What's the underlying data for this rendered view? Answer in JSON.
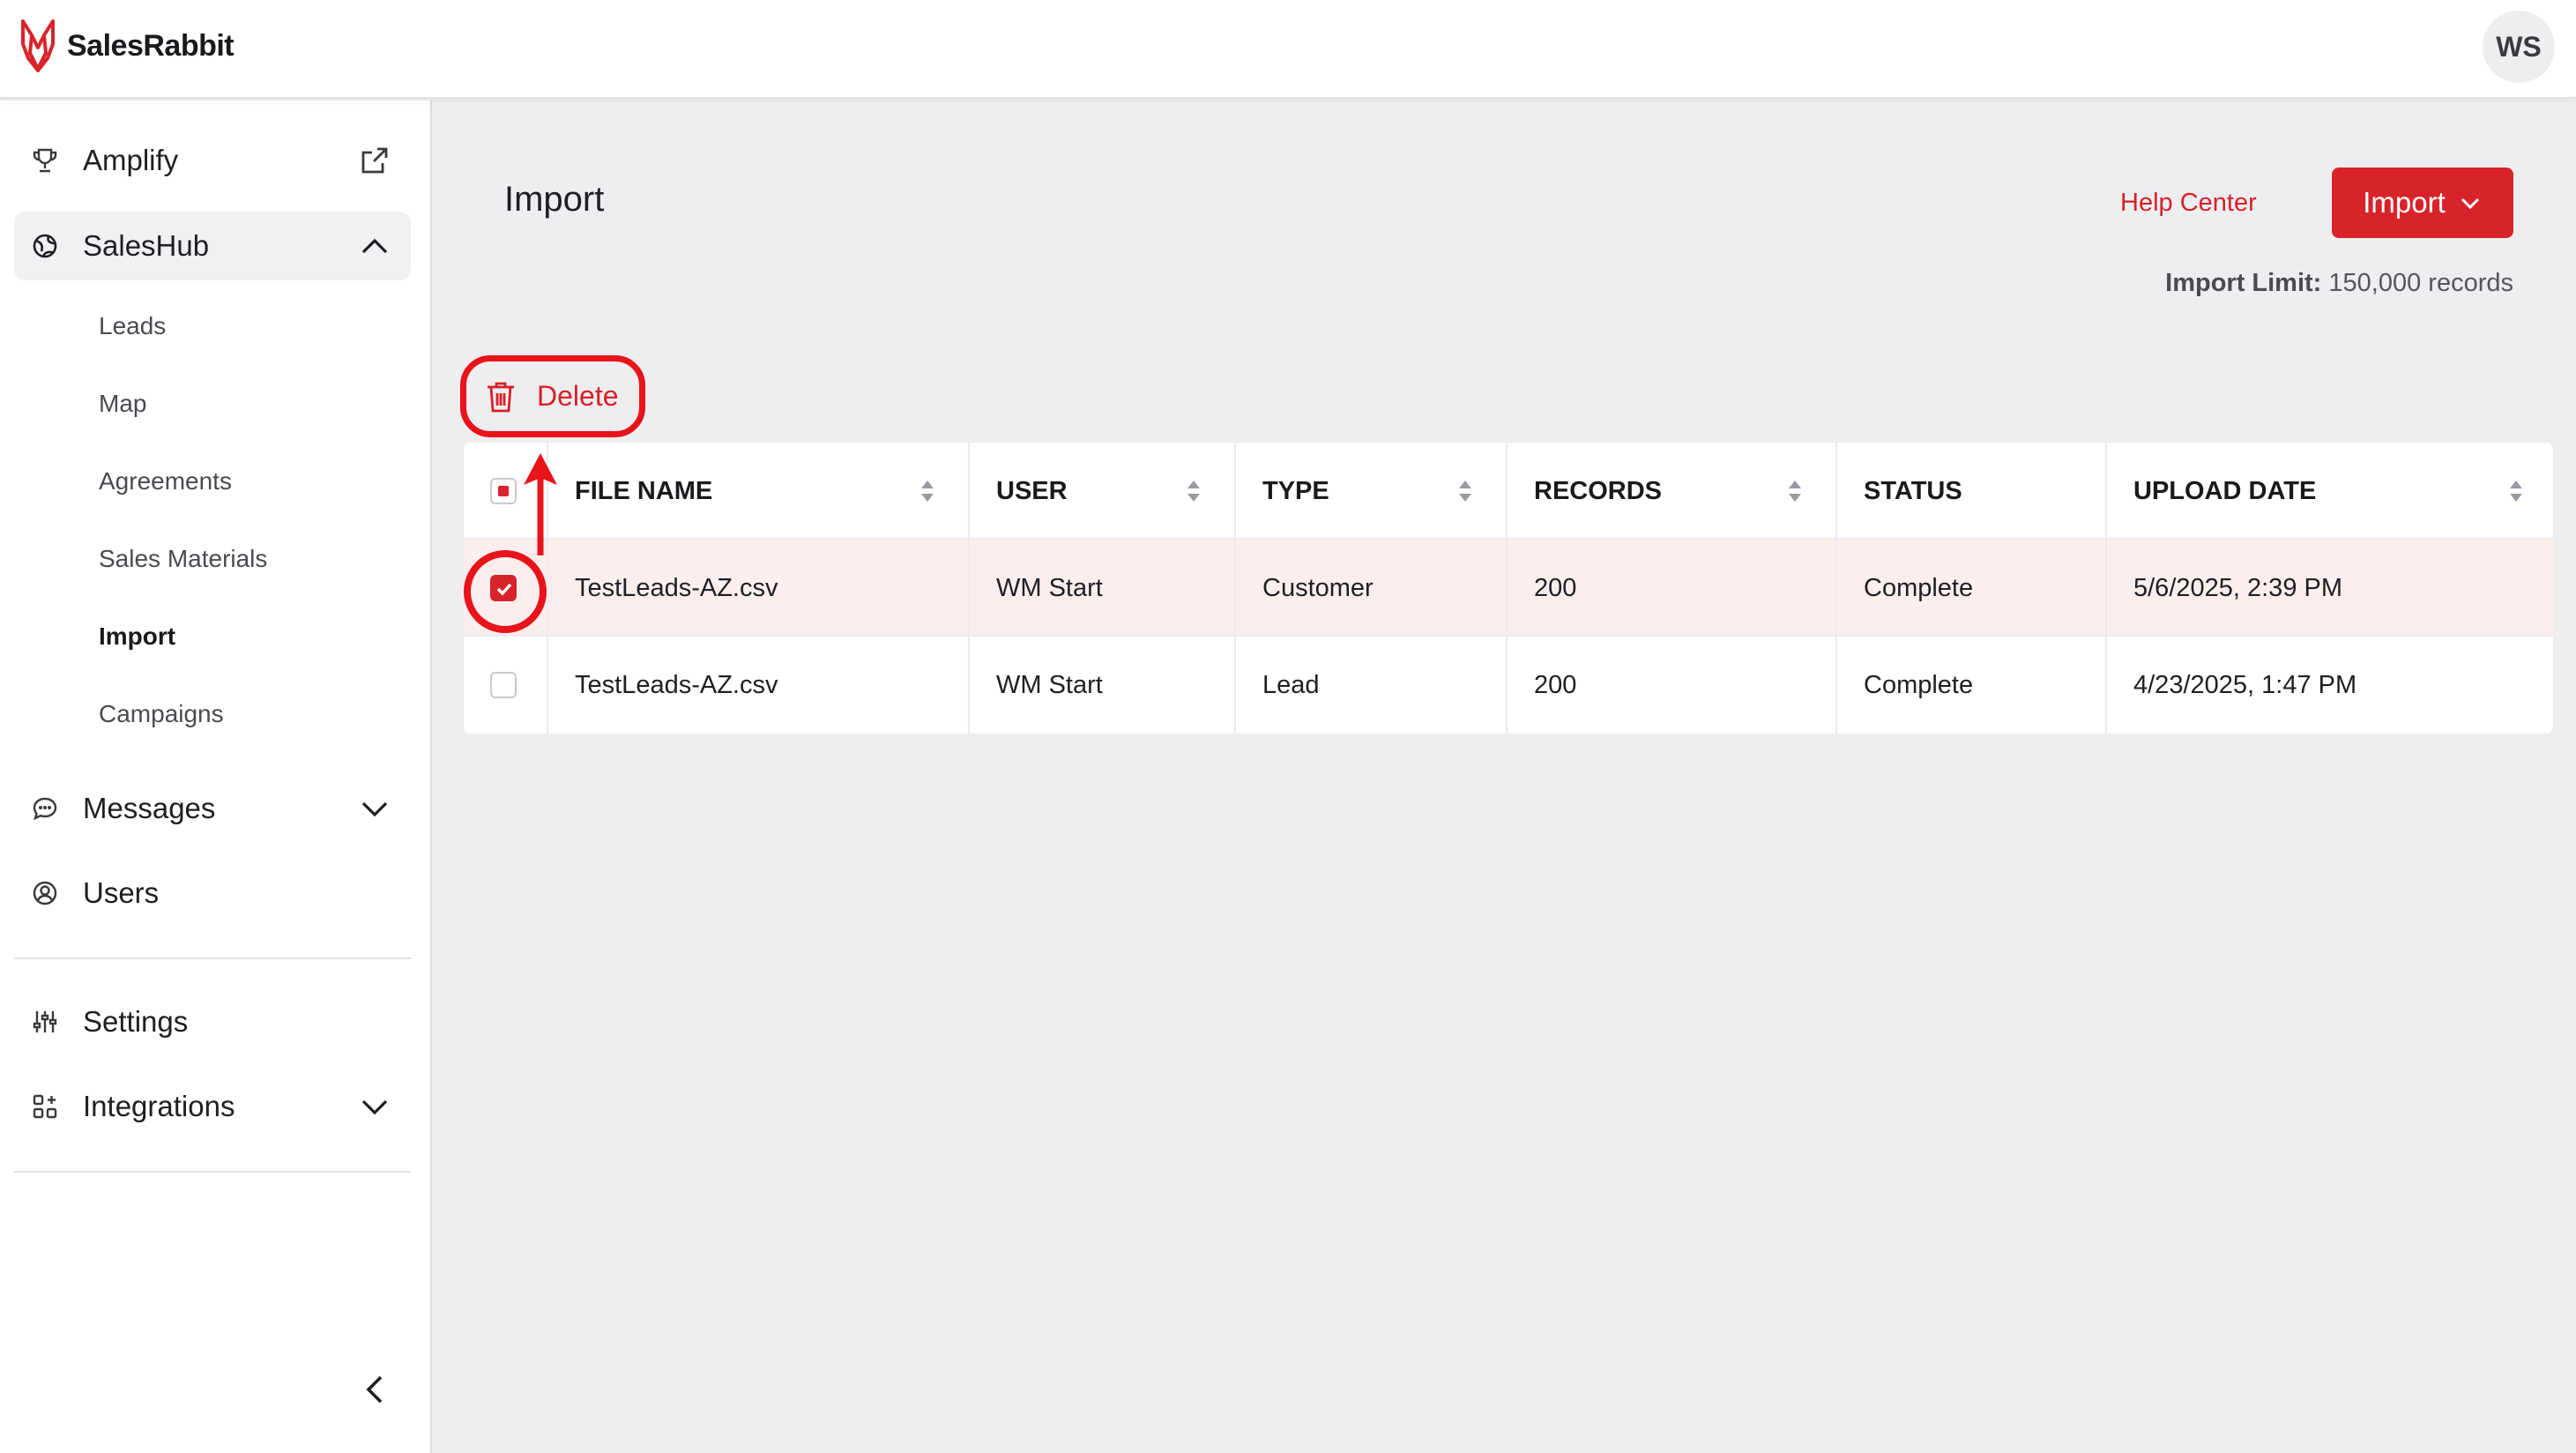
{
  "app": {
    "name": "SalesRabbit",
    "user_initials": "WS"
  },
  "sidebar": {
    "items": [
      {
        "label": "Amplify",
        "icon": "trophy-icon",
        "trail": "external-link-icon"
      },
      {
        "label": "SalesHub",
        "icon": "globe-icon",
        "trail": "chevron-up-icon",
        "expanded": true
      },
      {
        "label": "Messages",
        "icon": "chat-icon",
        "trail": "chevron-down-icon"
      },
      {
        "label": "Users",
        "icon": "user-circle-icon"
      },
      {
        "label": "Settings",
        "icon": "sliders-icon"
      },
      {
        "label": "Integrations",
        "icon": "grid-plus-icon",
        "trail": "chevron-down-icon"
      }
    ],
    "saleshub_children": [
      "Leads",
      "Map",
      "Agreements",
      "Sales Materials",
      "Import",
      "Campaigns"
    ],
    "active_child": "Import"
  },
  "main": {
    "title": "Import",
    "help_link": "Help Center",
    "import_button": "Import",
    "import_limit_label": "Import Limit:",
    "import_limit_value": "150,000 records",
    "delete_button": "Delete"
  },
  "table": {
    "columns": [
      "FILE NAME",
      "USER",
      "TYPE",
      "RECORDS",
      "STATUS",
      "UPLOAD DATE"
    ],
    "rows": [
      {
        "file": "TestLeads-AZ.csv",
        "user": "WM Start",
        "type": "Customer",
        "records": "200",
        "status": "Complete",
        "date": "5/6/2025, 2:39 PM",
        "selected": true
      },
      {
        "file": "TestLeads-AZ.csv",
        "user": "WM Start",
        "type": "Lead",
        "records": "200",
        "status": "Complete",
        "date": "4/23/2025, 1:47 PM",
        "selected": false
      }
    ]
  },
  "colors": {
    "accent": "#d9232a",
    "annotation": "#e8141a",
    "selected_row": "#fdeeee",
    "background": "#eeeef0"
  }
}
